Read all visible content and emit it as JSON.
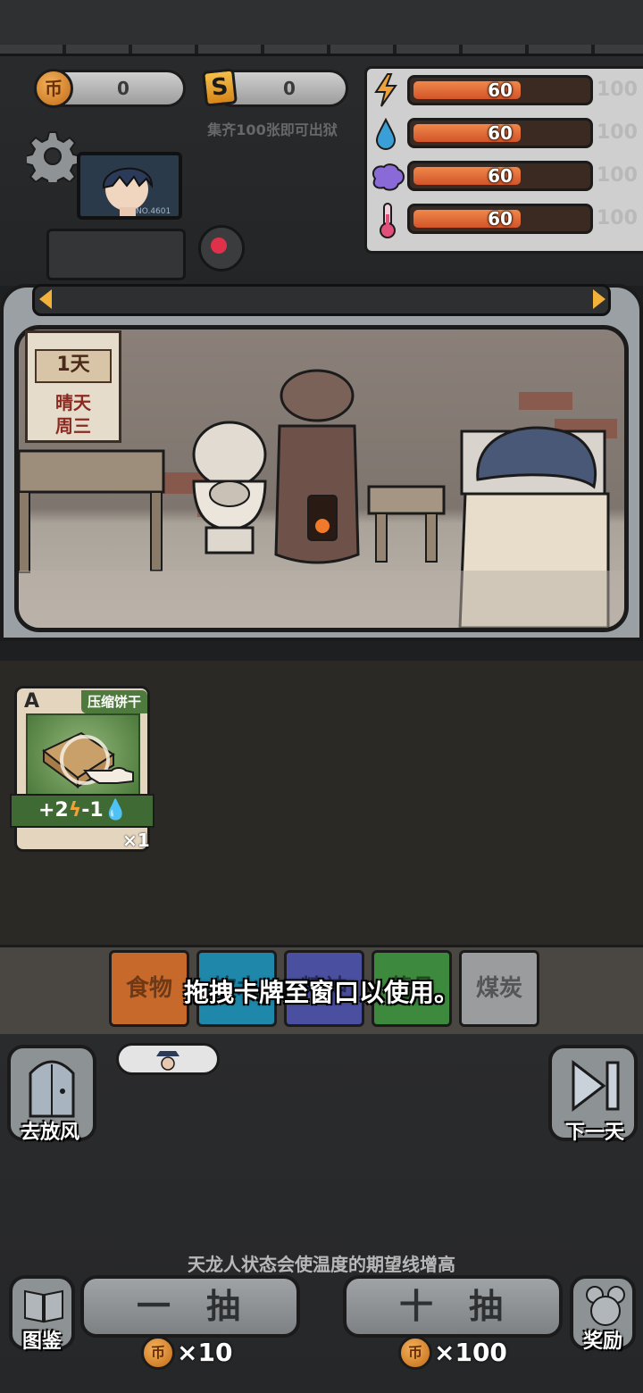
{
  "currency": {
    "coins": "0",
    "s_tokens": "0",
    "coin_glyph": "币",
    "s_glyph": "S"
  },
  "top_hint": "集齐100张即可出狱",
  "monitor": {
    "label": "NO.4601"
  },
  "stats": [
    {
      "icon": "energy-icon",
      "value": "60",
      "max": "100",
      "fill": 0.6
    },
    {
      "icon": "water-icon",
      "value": "60",
      "max": "100",
      "fill": 0.6
    },
    {
      "icon": "brain-icon",
      "value": "60",
      "max": "100",
      "fill": 0.6
    },
    {
      "icon": "thermometer-icon",
      "value": "60",
      "max": "100",
      "fill": 0.6
    }
  ],
  "calendar": {
    "day": "1天",
    "weather": "晴天",
    "weekday": "周三"
  },
  "card": {
    "grade": "A",
    "name": "压缩饼干",
    "effect_plus": "+2",
    "effect_minus": "-1",
    "count": "×1"
  },
  "categories": [
    {
      "label": "食物",
      "color": "#c7692b"
    },
    {
      "label": "饮水",
      "color": "#1f87a9"
    },
    {
      "label": "精神",
      "color": "#4a4fa0"
    },
    {
      "label": "药品",
      "color": "#3d8a3f"
    },
    {
      "label": "煤炭",
      "color": "#9b9c9d"
    }
  ],
  "tooltip": "拖拽卡牌至窗口以使用。",
  "buttons": {
    "go_out": "去放风",
    "next_day": "下一天",
    "codex": "图鉴",
    "reward": "奖励"
  },
  "bottom_hint": "天龙人状态会使温度的期望线增高",
  "draw": {
    "single_label": "一抽",
    "single_cost": "×10",
    "ten_label": "十抽",
    "ten_cost": "×100"
  }
}
